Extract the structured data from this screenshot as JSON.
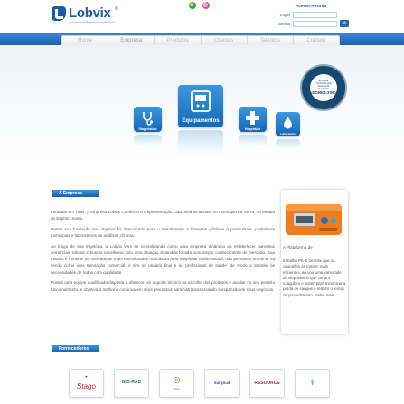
{
  "header": {
    "brand": "Lobvix",
    "brand_reg": "®",
    "tagline": "Comércio e Representação Ltda",
    "lang_pt_icon": "brazil-flag-icon",
    "lang_en_icon": "language-flag-icon"
  },
  "login": {
    "title": "Acesso Restrito",
    "user_label": "Login",
    "pass_label": "Senha",
    "go_label": "ok"
  },
  "nav": {
    "items": [
      "Home",
      "Empresa",
      "Produtos",
      "Clientes",
      "Talentos",
      "Contato"
    ],
    "active_index": 1
  },
  "categories": [
    {
      "label": "Diagnóstico",
      "icon": "stethoscope-icon"
    },
    {
      "label": "Equipamentos",
      "icon": "monitor-device-icon"
    },
    {
      "label": "Hospitalar",
      "icon": "medical-cross-icon"
    },
    {
      "label": "Laboratório",
      "icon": "water-drop-icon"
    }
  ],
  "seal": {
    "top_text": "Empresa Certificada pelo Sistema de Qualidade",
    "standard": "ISO9001:2000"
  },
  "about": {
    "heading": "A Empresa",
    "paragraphs": [
      "Fundada em 1994, a empresa Lobvix Comércio e Representação Ltda. está localizada no município da Serra, no estado do Espírito Santo.",
      "Desde sua fundação seu objetivo foi direcionado para o atendimento a hospitais públicos e particulares, prefeituras municipais e laboratórios de análises clínicas.",
      "Ao longo de sua trajetória, a Lobvix vem se consolidando como uma empresa dinâmica ao estabelecer parcerias comerciais sólidas e buscar excelência com uma atuação visionária focada num amplo conhecimento de mercado. Sua missão é fornecer ao mercado as mais conceituadas marcas da área hospitalar e laboratorial, não pensando somente na venda como uma transação comercial, e sim no usuário final e no profissional de saúde, de modo a atender às necessidades de todos com qualidade.",
      "Possui uma equipe qualificada disposta a oferecer um suporte técnico na escolha dos produtos e auxiliar no seu perfeito funcionamento, e objetiva a melhoria contínua em seus processos administrativos visando à expansão de seus negócios."
    ]
  },
  "product": {
    "heading": "A Plataforma de",
    "description": "trabalho PK-B permite que os cirurgiões as tomem mais eficientes, ao unir uma variedade de dispositivos que cortam, coagulam e selam para minimizar a perda de sangue e reduzir o tempo de procedimento. Saiba mais..."
  },
  "suppliers": {
    "heading": "Fornecedores",
    "logos": [
      {
        "text": "Stago",
        "color": "#c0282d"
      },
      {
        "text": "BIO-RAD",
        "color": "#2a8a3e"
      },
      {
        "text": "CRAL",
        "color": "#8a6a3c"
      },
      {
        "text": "surgical",
        "color": "#2b4fa0"
      },
      {
        "text": "RESOURCE",
        "color": "#c0282d"
      },
      {
        "text": "",
        "color": "#2b4fa0"
      }
    ]
  }
}
